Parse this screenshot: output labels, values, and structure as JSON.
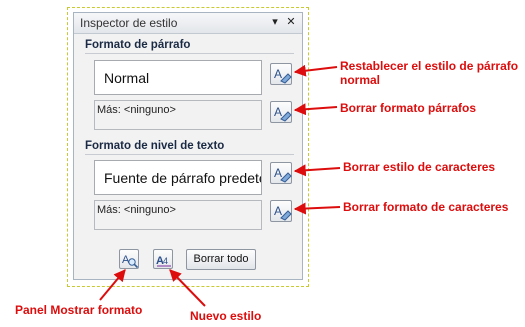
{
  "pane": {
    "title": "Inspector de estilo",
    "dropdown_glyph": "▾",
    "close_glyph": "✕"
  },
  "paragraph_section": {
    "title": "Formato de párrafo",
    "style_value": "Normal",
    "more_value": "Más: <ninguno>"
  },
  "text_section": {
    "title": "Formato de nivel de texto",
    "style_value": "Fuente de párrafo predeterminada",
    "more_value": "Más: <ninguno>"
  },
  "bottom": {
    "clear_all_label": "Borrar todo"
  },
  "annotations": {
    "reset_paragraph": "Restablecer el estilo de párrafo normal",
    "reset_paragraph_line1": "Restablecer el estilo de párrafo",
    "reset_paragraph_line2": "normal",
    "clear_paragraph_format": "Borrar formato párrafos",
    "clear_char_style": "Borrar estilo de caracteres",
    "clear_char_format": "Borrar formato de caracteres",
    "show_formatting_panel": "Panel Mostrar formato",
    "new_style": "Nuevo estilo"
  },
  "colors": {
    "annotation_red": "#dd0d0d",
    "selection_border": "#c9c930",
    "pane_border": "#a9b4c2"
  },
  "icons": {
    "reset_button": "eraser-a-icon",
    "reveal_formatting": "magnifier-a-icon",
    "new_style": "new-style-a4-icon"
  }
}
